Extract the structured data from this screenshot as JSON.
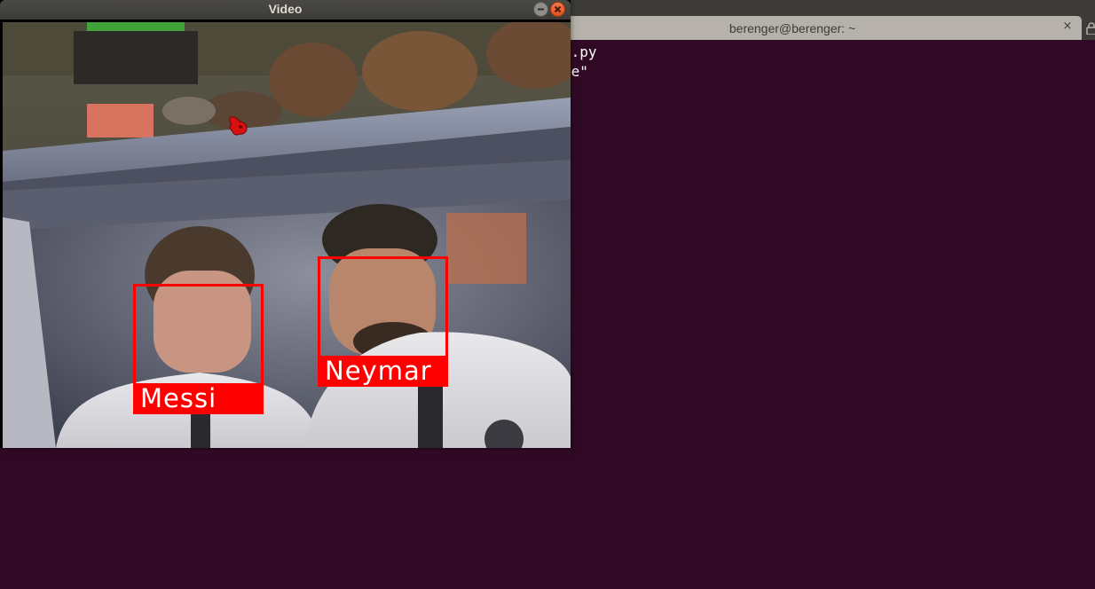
{
  "terminal": {
    "tab_title": "berenger@berenger: ~",
    "close_glyph": "×",
    "lines": [
      "n.py",
      "le\""
    ]
  },
  "video_window": {
    "title": "Video",
    "detections": [
      {
        "label": "Messi"
      },
      {
        "label": "Neymar"
      }
    ]
  },
  "colors": {
    "terminal_background": "#300a24",
    "titlebar": "#3c3b37",
    "tab": "#b6b2ab",
    "detection_box": "#ff0000",
    "close_button": "#e95420"
  },
  "icons": {
    "minimize": "minimize-icon",
    "close": "close-icon",
    "cursor": "mouse-cursor-icon",
    "next_tab": "lock-icon"
  }
}
